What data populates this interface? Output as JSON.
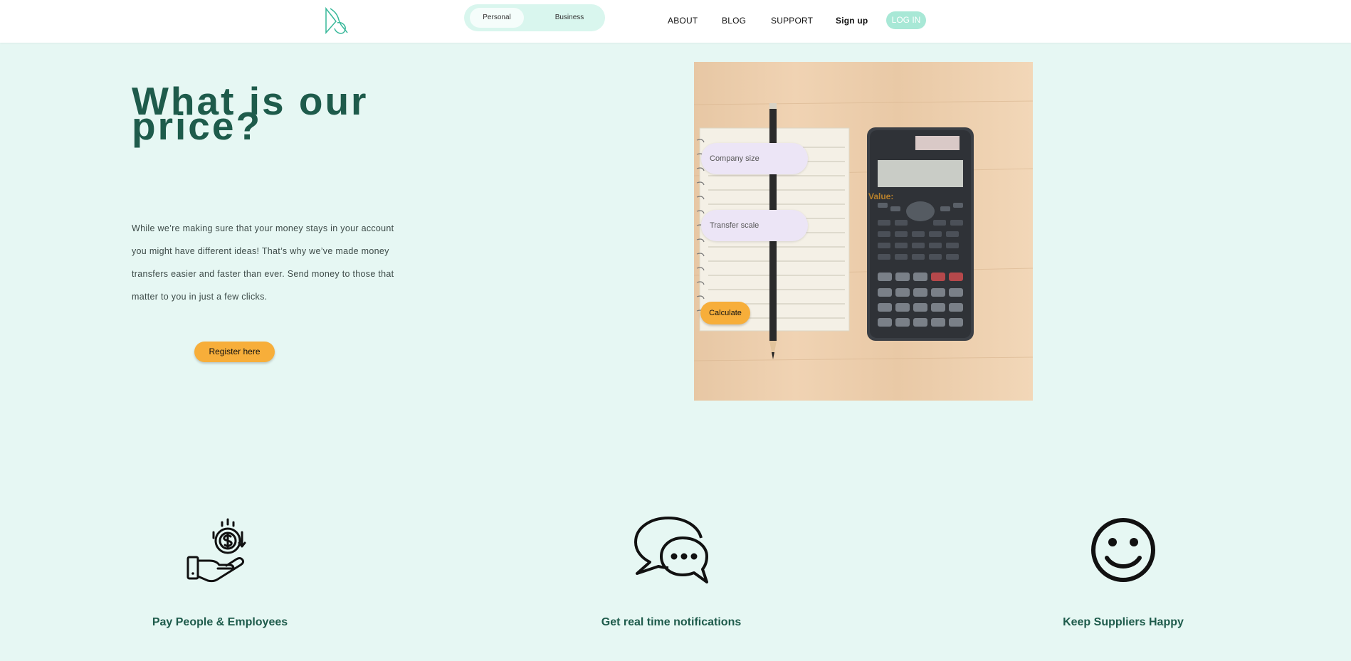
{
  "brand": {
    "logo_icon": "brand-logo-icon"
  },
  "mode_toggle": {
    "personal_label": "Personal",
    "business_label": "Business",
    "selected": "Personal"
  },
  "nav": {
    "about": "ABOUT",
    "blog": "BLOG",
    "support": "SUPPORT",
    "signup": "Sign up",
    "login": "LOG IN"
  },
  "hero": {
    "title_line1": "What is our",
    "title_line2": "price?",
    "body_lines": [
      "While we’re making sure that your money stays in your account",
      "you might have different ideas! That’s why we’ve made money",
      "transfers easier and faster than ever. Send money to those that",
      "matter to you in just a few clicks."
    ],
    "register_label": "Register here"
  },
  "calculator": {
    "company_size_placeholder": "Company size",
    "transfer_scale_placeholder": "Transfer scale",
    "value_label": "Value:",
    "calculate_label": "Calculate"
  },
  "features": [
    {
      "icon": "hand-coin-dollar-icon",
      "label": "Pay People & Employees"
    },
    {
      "icon": "chat-bubbles-icon",
      "label": "Get real time notifications"
    },
    {
      "icon": "smiley-face-icon",
      "label": "Keep Suppliers Happy"
    }
  ],
  "colors": {
    "page_background": "#e6f7f3",
    "heading": "#1e5b4b",
    "accent_orange": "#f7ae3a",
    "login_mint": "#a8e8d6",
    "input_lavender": "#ece5f6"
  }
}
